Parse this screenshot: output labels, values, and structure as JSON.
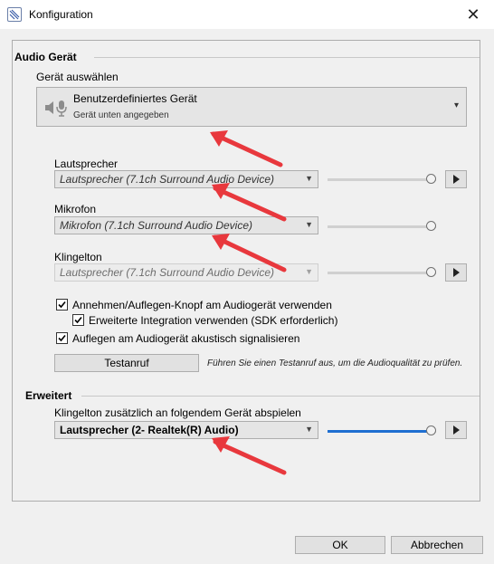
{
  "window": {
    "title": "Konfiguration",
    "close_glyph": "✕"
  },
  "audio": {
    "section_title": "Audio Gerät",
    "select_label": "Gerät auswählen",
    "device": {
      "name": "Benutzerdefiniertes Gerät",
      "subtitle": "Gerät unten angegeben",
      "icon": "microphone-speaker-icon"
    },
    "speaker": {
      "label": "Lautsprecher",
      "value": "Lautsprecher (7.1ch Surround Audio Device)",
      "volume": 1.0
    },
    "microphone": {
      "label": "Mikrofon",
      "value": "Mikrofon (7.1ch Surround Audio Device)",
      "volume": 1.0
    },
    "ringtone": {
      "label": "Klingelton",
      "value": "Lautsprecher (7.1ch Surround Audio Device)",
      "volume": 1.0,
      "disabled": true
    },
    "check_accept": "Annehmen/Auflegen-Knopf am Audiogerät verwenden",
    "check_extended": "Erweiterte Integration verwenden (SDK erforderlich)",
    "check_signal": "Auflegen am Audiogerät akustisch signalisieren",
    "test_button": "Testanruf",
    "test_hint": "Führen Sie einen Testanruf aus, um die Audioqualität zu prüfen."
  },
  "advanced": {
    "section_title": "Erweitert",
    "ring_label": "Klingelton zusätzlich an folgendem Gerät abspielen",
    "ring_value": "Lautsprecher (2- Realtek(R) Audio)",
    "volume": 1.0
  },
  "footer": {
    "ok": "OK",
    "cancel": "Abbrechen"
  },
  "colors": {
    "accent": "#1f6fd1",
    "annotation_arrow": "#e8383d"
  }
}
